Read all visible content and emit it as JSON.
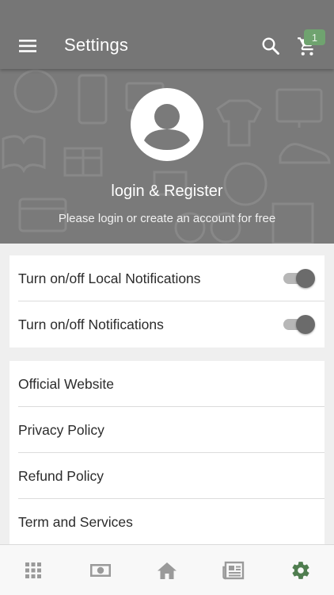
{
  "app_bar": {
    "title": "Settings",
    "cart_count": "1"
  },
  "profile": {
    "title": "login & Register",
    "subtitle": "Please login or create an account for free"
  },
  "toggles": [
    {
      "label": "Turn on/off Local Notifications",
      "on": true
    },
    {
      "label": "Turn on/off Notifications",
      "on": true
    }
  ],
  "links": [
    {
      "label": "Official Website"
    },
    {
      "label": "Privacy Policy"
    },
    {
      "label": "Refund Policy"
    },
    {
      "label": "Term and Services"
    }
  ],
  "bottom_nav": {
    "items": [
      {
        "icon": "apps-grid-icon",
        "active": false
      },
      {
        "icon": "money-icon",
        "active": false
      },
      {
        "icon": "home-icon",
        "active": false
      },
      {
        "icon": "news-icon",
        "active": false
      },
      {
        "icon": "settings-gear-icon",
        "active": true
      }
    ],
    "active_color": "#4f7d4f",
    "inactive_color": "#9a9a9a"
  },
  "colors": {
    "app_bar": "#767676",
    "header_bg": "#7a7a7a",
    "badge": "#6fa36f",
    "page_bg": "#efefef"
  }
}
